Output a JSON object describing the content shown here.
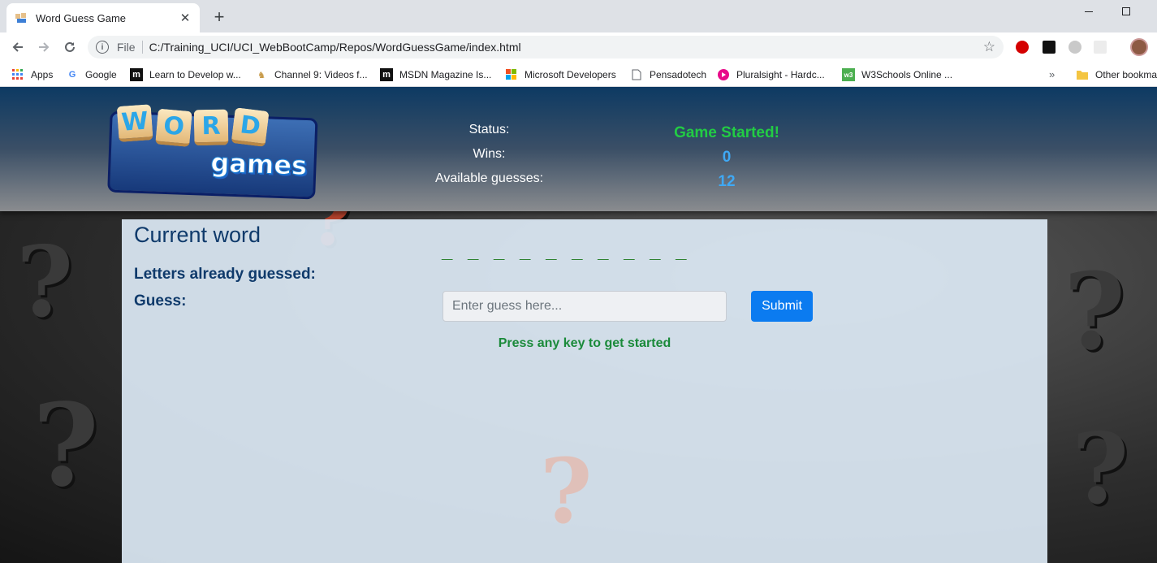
{
  "browser": {
    "tab_title": "Word Guess Game",
    "new_tab": "+",
    "address_prefix": "File",
    "url": "C:/Training_UCI/UCI_WebBootCamp/Repos/WordGuessGame/index.html"
  },
  "bookmarks": [
    {
      "label": "Apps",
      "icon": "apps-grid-icon"
    },
    {
      "label": "Google",
      "icon": "google-icon"
    },
    {
      "label": "Learn to Develop w...",
      "icon": "m-icon"
    },
    {
      "label": "Channel 9: Videos f...",
      "icon": "channel9-icon"
    },
    {
      "label": "MSDN Magazine Is...",
      "icon": "m-icon"
    },
    {
      "label": "Microsoft Developers",
      "icon": "microsoft-icon"
    },
    {
      "label": "Pensadotech",
      "icon": "page-icon"
    },
    {
      "label": "Pluralsight - Hardc...",
      "icon": "pluralsight-icon"
    },
    {
      "label": "W3Schools Online ...",
      "icon": "w3schools-icon"
    },
    {
      "label": "Other bookmarks",
      "icon": "folder-icon"
    }
  ],
  "bookmarks_overflow": "»",
  "game": {
    "status_label": "Status:",
    "status_value": "Game Started!",
    "wins_label": "Wins:",
    "wins_value": "0",
    "guesses_label": "Available guesses:",
    "guesses_value": "12",
    "current_word_label": "Current word",
    "word_blanks": "_ _ _ _ _ _ _ _ _ _",
    "letters_guessed_label": "Letters already guessed:",
    "guess_label": "Guess:",
    "guess_placeholder": "Enter guess here...",
    "submit_label": "Submit",
    "hint": "Press any key to get started"
  },
  "logo": {
    "tiles": [
      "W",
      "O",
      "R",
      "D"
    ],
    "games_text": "games"
  },
  "colors": {
    "status_green": "#22cc44",
    "value_blue": "#3fa9f5",
    "label_navy": "#0f3a6b",
    "submit_blue": "#0b7bf0",
    "hint_green": "#1a8a3a"
  }
}
